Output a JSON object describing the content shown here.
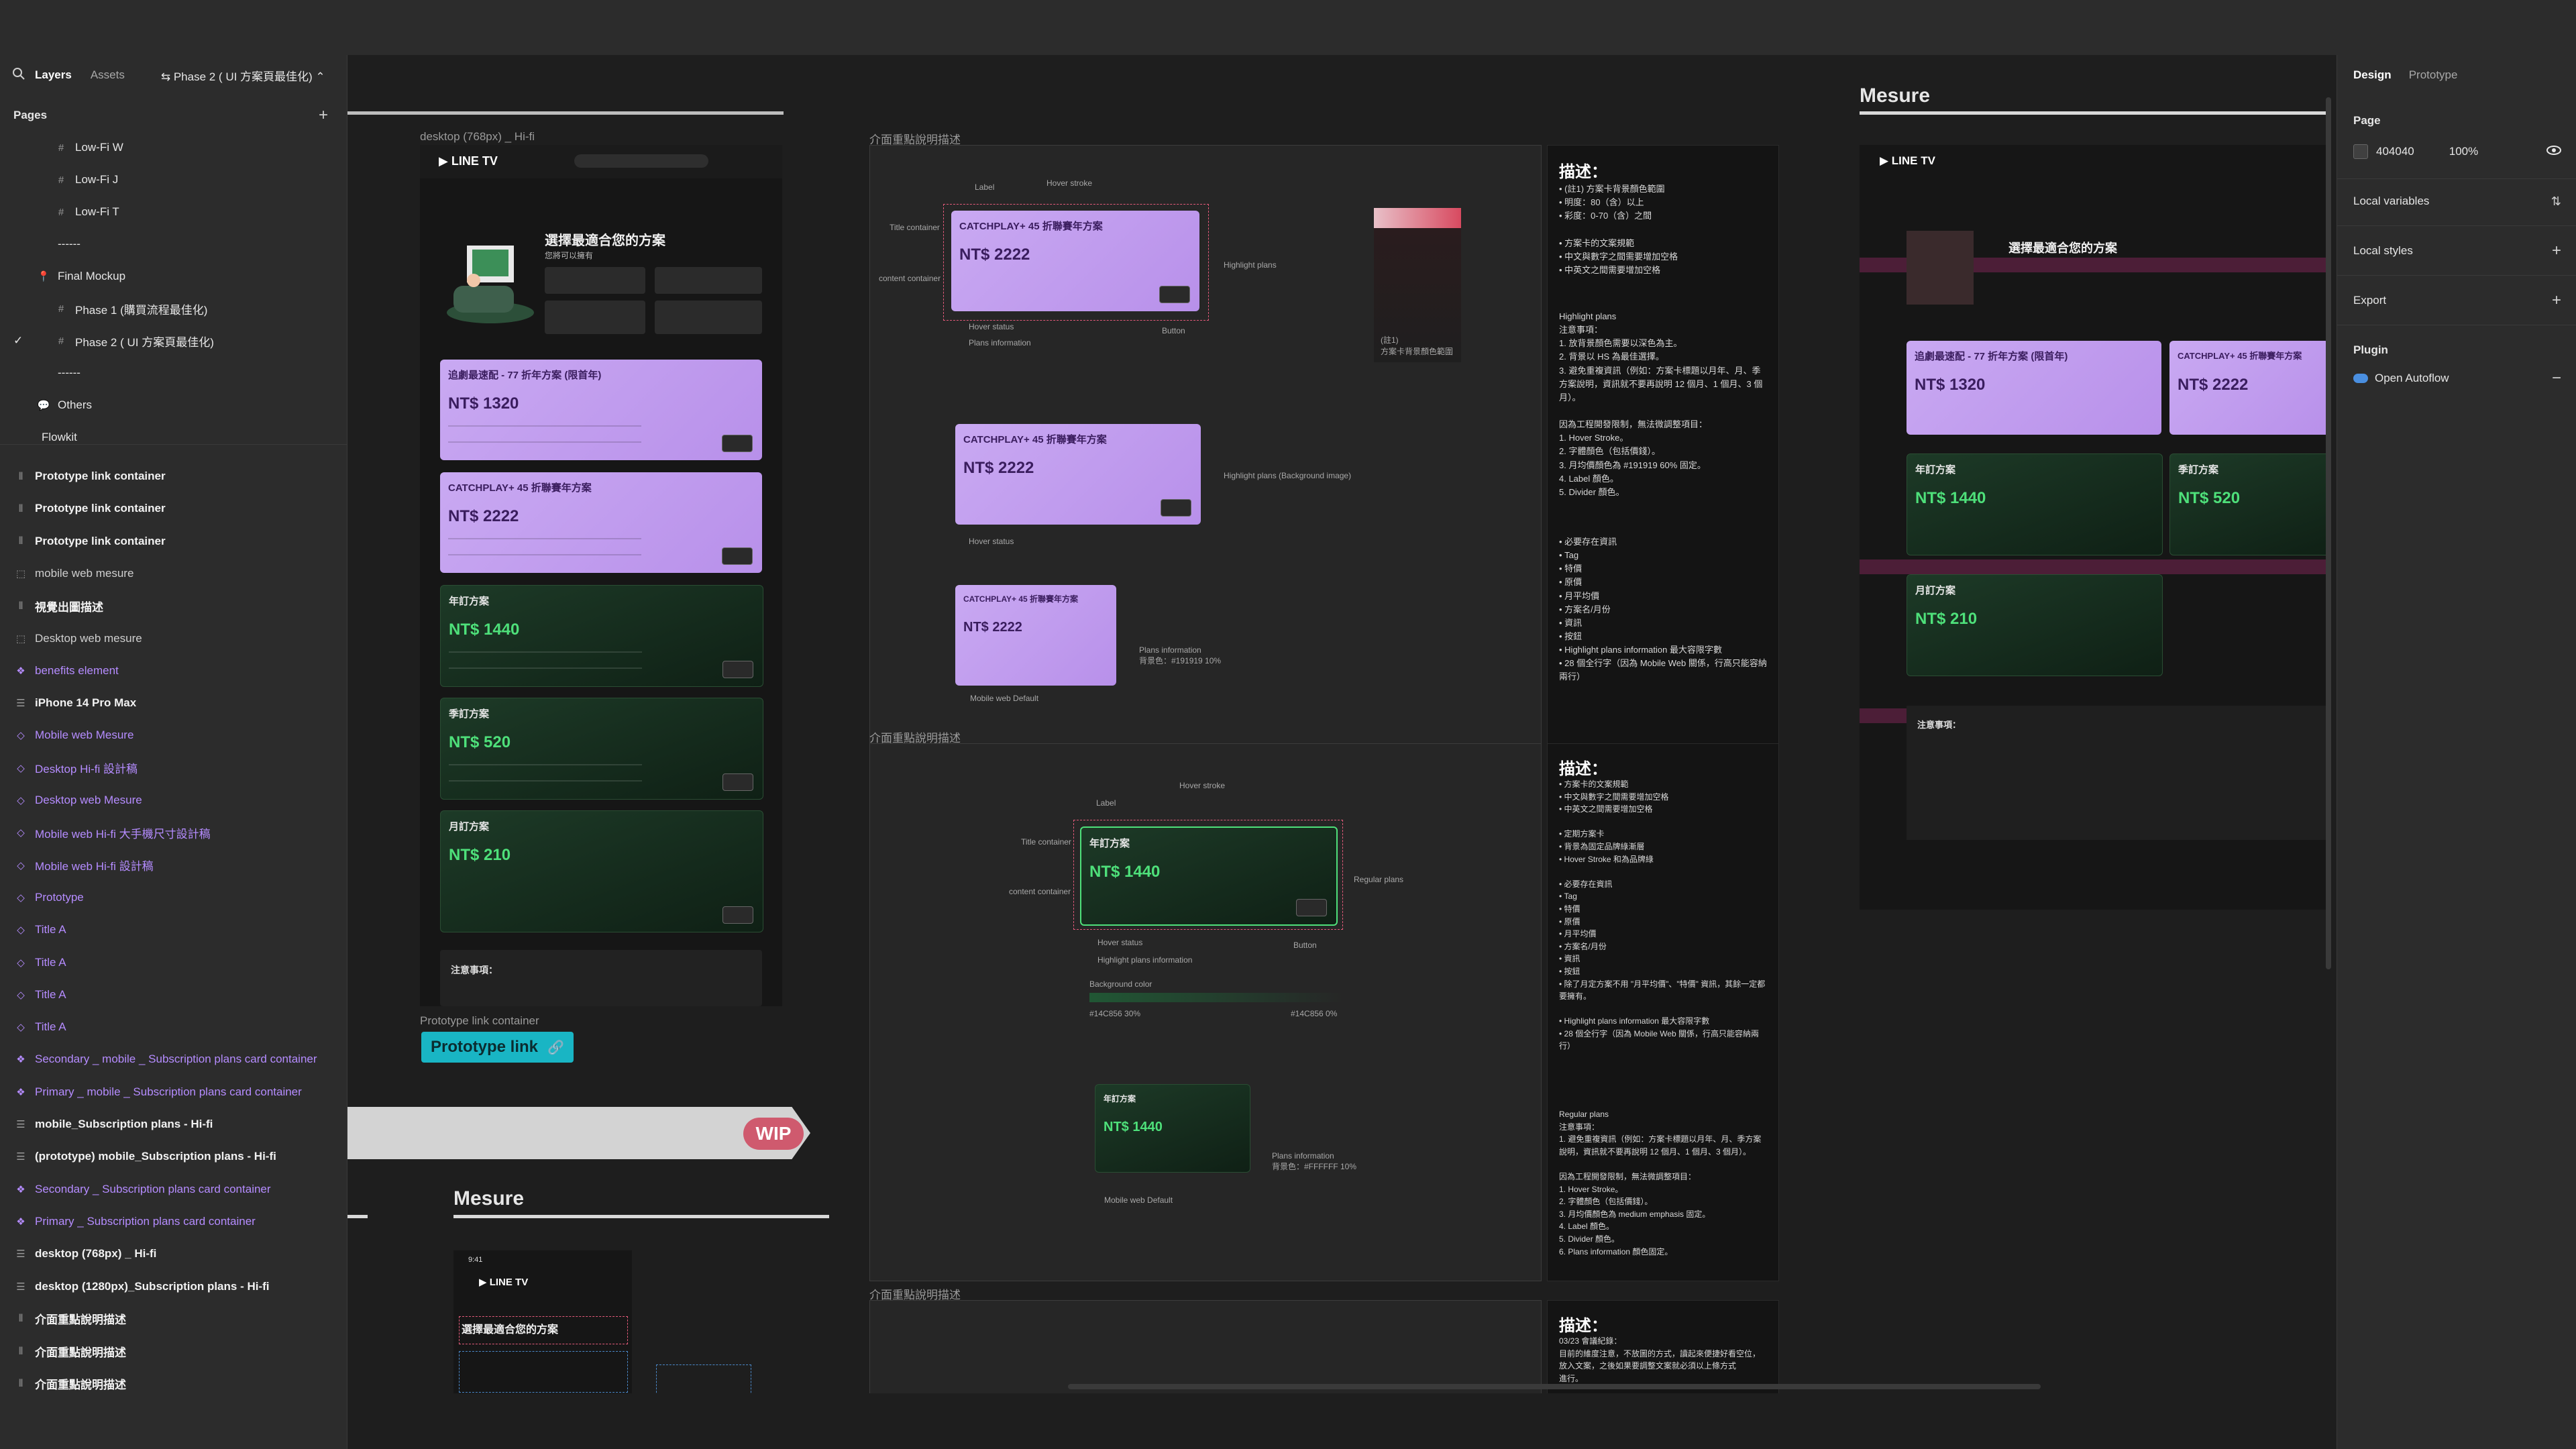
{
  "left_panel": {
    "tabs": [
      "Layers",
      "Assets"
    ],
    "current_page": "Phase 2 ( UI 方案頁最佳化)",
    "pages_heading": "Pages",
    "pages": [
      {
        "label": "Low-Fi W",
        "icon": "hash-icon"
      },
      {
        "label": "Low-Fi J",
        "icon": "hash-icon"
      },
      {
        "label": "Low-Fi T",
        "icon": "hash-icon"
      },
      {
        "label": "------",
        "icon": ""
      },
      {
        "label": "Final Mockup",
        "icon": "pin-icon"
      },
      {
        "label": "Phase 1 (購買流程最佳化)",
        "icon": "hash-icon"
      },
      {
        "label": "Phase 2 ( UI 方案頁最佳化)",
        "icon": "hash-icon"
      },
      {
        "label": "------",
        "icon": ""
      },
      {
        "label": "Others",
        "icon": "speech-bubble-icon"
      },
      {
        "label": "Flowkit",
        "icon": ""
      }
    ],
    "layers": [
      {
        "label": "Prototype link container",
        "icon": "column-icon",
        "style": "bold"
      },
      {
        "label": "Prototype link container",
        "icon": "column-icon",
        "style": "bold"
      },
      {
        "label": "Prototype link container",
        "icon": "column-icon",
        "style": "bold"
      },
      {
        "label": "mobile web mesure",
        "icon": "frame-icon",
        "style": "normal"
      },
      {
        "label": "視覺出圖描述",
        "icon": "column-icon",
        "style": "bold"
      },
      {
        "label": "Desktop web mesure",
        "icon": "frame-icon",
        "style": "normal"
      },
      {
        "label": "benefits element",
        "icon": "component-icon",
        "style": "purple"
      },
      {
        "label": "iPhone 14 Pro Max",
        "icon": "list-icon",
        "style": "bold"
      },
      {
        "label": "Mobile web Mesure",
        "icon": "diamond-icon",
        "style": "purple"
      },
      {
        "label": "Desktop Hi-fi 設計稿",
        "icon": "diamond-icon",
        "style": "purple"
      },
      {
        "label": "Desktop web Mesure",
        "icon": "diamond-icon",
        "style": "purple"
      },
      {
        "label": "Mobile web Hi-fi 大手機尺寸設計稿",
        "icon": "diamond-icon",
        "style": "purple"
      },
      {
        "label": "Mobile web Hi-fi 設計稿",
        "icon": "diamond-icon",
        "style": "purple"
      },
      {
        "label": "Prototype",
        "icon": "diamond-icon",
        "style": "purple"
      },
      {
        "label": "Title A",
        "icon": "diamond-icon",
        "style": "purple"
      },
      {
        "label": "Title A",
        "icon": "diamond-icon",
        "style": "purple"
      },
      {
        "label": "Title A",
        "icon": "diamond-icon",
        "style": "purple"
      },
      {
        "label": "Title A",
        "icon": "diamond-icon",
        "style": "purple"
      },
      {
        "label": "Secondary _ mobile _ Subscription plans card container",
        "icon": "component-icon",
        "style": "purple"
      },
      {
        "label": "Primary _ mobile _ Subscription plans card container",
        "icon": "component-icon",
        "style": "purple"
      },
      {
        "label": "mobile_Subscription plans - Hi-fi",
        "icon": "list-icon",
        "style": "bold"
      },
      {
        "label": "(prototype) mobile_Subscription plans - Hi-fi",
        "icon": "list-icon",
        "style": "bold"
      },
      {
        "label": "Secondary _ Subscription plans card container",
        "icon": "component-icon",
        "style": "purple"
      },
      {
        "label": "Primary _ Subscription plans card container",
        "icon": "component-icon",
        "style": "purple"
      },
      {
        "label": "desktop (768px) _ Hi-fi",
        "icon": "list-icon",
        "style": "bold"
      },
      {
        "label": "desktop (1280px)_Subscription plans - Hi-fi",
        "icon": "list-icon",
        "style": "bold"
      },
      {
        "label": "介面重點說明描述",
        "icon": "column-icon",
        "style": "bold"
      },
      {
        "label": "介面重點說明描述",
        "icon": "column-icon",
        "style": "bold"
      },
      {
        "label": "介面重點說明描述",
        "icon": "column-icon",
        "style": "bold"
      }
    ]
  },
  "canvas": {
    "frame_desktop_768": "desktop (768px) _ Hi-fi",
    "frame_desc_1": "介面重點說明描述",
    "frame_desc_2": "介面重點說明描述",
    "frame_desc_3": "介面重點說明描述",
    "mesure_top": "Mesure",
    "mesure_bottom": "Mesure",
    "prototype_container_label": "Prototype link container",
    "prototype_link": "Prototype link",
    "wip": "WIP",
    "logo": "LINE TV",
    "mock_heading": "選擇最適合您的方案",
    "mock_subheading": "您將可以擁有",
    "plans": [
      {
        "title": "追劇最速配 - 77 折年方案 (限首年)",
        "price": "NT$ 1320",
        "kind": "purple"
      },
      {
        "title": "CATCHPLAY+ 45 折聯賽年方案",
        "price": "NT$ 2222",
        "kind": "purple"
      },
      {
        "title": "年訂方案",
        "price": "NT$ 1440",
        "kind": "green"
      },
      {
        "title": "季訂方案",
        "price": "NT$ 520",
        "kind": "green"
      },
      {
        "title": "月訂方案",
        "price": "NT$ 210",
        "kind": "green"
      }
    ],
    "notice_title": "注意事項：",
    "desc_heading": "描述：",
    "desc1_text": "• (註1) 方案卡背景顏色範圍\n  • 明度：80（含）以上\n  • 彩度：0-70（含）之間\n\n• 方案卡的文案規範\n  • 中文與數字之間需要增加空格\n  • 中英文之間需要增加空格",
    "desc1_highlight": "Highlight plans\n注意事項：\n1. 放背景顏色需要以深色為主。\n2. 背景以 HS 為最佳選擇。\n3. 避免重複資訊（例如：方案卡標題以月年、月、季方案說明，資訊就不要再說明 12 個月、1 個月、3 個月）。\n\n因為工程開發限制，無法微調整項目：\n1. Hover Stroke。\n2. 字體顏色（包括價錢）。\n3. 月均價顏色為 #191919 60% 固定。\n4. Label 顏色。\n5. Divider 顏色。",
    "desc1_required": "• 必要存在資訊\n  • Tag\n  • 特價\n  • 原價\n  • 月平均價\n  • 方案名/月份\n  • 資訊\n  • 按鈕\n• Highlight plans information 最大容限字數\n  • 28 個全行字（因為 Mobile Web 關係，行高只能容納兩行）",
    "desc2_text": "• 方案卡的文案規範\n  • 中文與數字之間需要增加空格\n  • 中英文之間需要增加空格\n\n• 定期方案卡\n  • 背景為固定品牌綠漸層\n  • Hover Stroke 和為品牌綠\n\n• 必要存在資訊\n  • Tag\n  • 特價\n  • 原價\n  • 月平均價\n  • 方案名/月份\n  • 資訊\n  • 按鈕\n• 除了月定方案不用 \"月平均價\"、\"特價\" 資訊，其餘一定都要擁有。\n\n• Highlight plans information 最大容限字數\n  • 28 個全行字（因為 Mobile Web 關係，行高只能容納兩行）",
    "desc2_regular": "Regular plans\n注意事項：\n1. 避免重複資訊（例如：方案卡標題以月年、月、季方案說明，資訊就不要再說明 12 個月、1 個月、3 個月）。\n\n因為工程開發限制，無法微調整項目：\n1. Hover Stroke。\n2. 字體顏色（包括價錢）。\n3. 月均價顏色為 medium emphasis 固定。\n4. Label 顏色。\n5. Divider 顏色。\n6. Plans information 顏色固定。",
    "desc3_text": "03/23 會議紀錄：\n目前的維度注意，不放圖的方式，讀起來便捷好看空位，放入文案，之後如果要調整文案就必須以上條方式\n進行。",
    "annotations": {
      "label": "Label",
      "hover_stroke": "Hover stroke",
      "title_container": "Title container",
      "content_container": "content container",
      "hover_status": "Hover status",
      "plans_information": "Plans information",
      "button": "Button",
      "highlight_plans": "Highlight plans",
      "highlight_plans_bg": "Highlight plans (Background image)",
      "mobile_web_default": "Mobile web Default",
      "regular_plans": "Regular plans",
      "highlight_plans_information": "Highlight plans information",
      "background_color": "Background color",
      "color_stop_1": "#14C856 30%",
      "color_stop_2": "#14C856 0%",
      "color_range_note": "(註1)\n方案卡背景顏色範圍",
      "plans_info_color_1": "Plans information\n背景色：#191919 10%",
      "plans_info_color_2": "Plans information\n背景色：#FFFFFF 10%"
    },
    "mobile_time": "9:41"
  },
  "right_panel": {
    "tabs": [
      "Design",
      "Prototype"
    ],
    "page_label": "Page",
    "page_color": "404040",
    "page_opacity": "100%",
    "local_variables": "Local variables",
    "local_styles": "Local styles",
    "export": "Export",
    "plugin_label": "Plugin",
    "plugin_name": "Open Autoflow"
  },
  "colors": {
    "panel_bg": "#2c2c2c",
    "canvas_bg": "#1e1e1e",
    "purple_card": "#c4a3f0",
    "green_card": "#183222",
    "brand_green": "#14C856",
    "accent_pink": "#e35a7a",
    "prototype_chip": "#19b5c4"
  },
  "help": "?"
}
